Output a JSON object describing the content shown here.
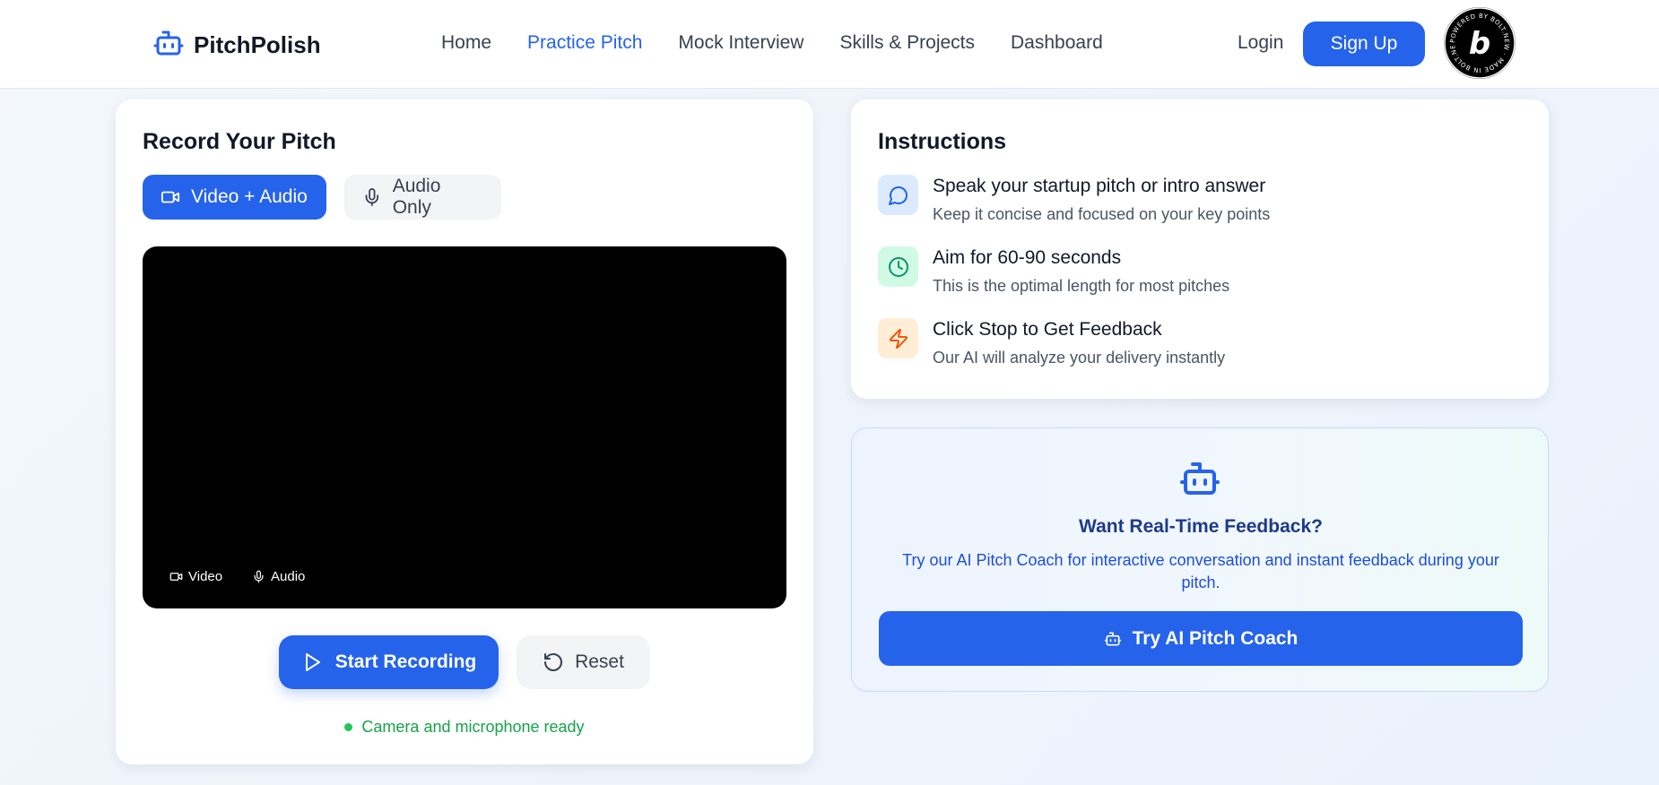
{
  "header": {
    "logo_text": "PitchPolish",
    "nav": [
      "Home",
      "Practice Pitch",
      "Mock Interview",
      "Skills & Projects",
      "Dashboard"
    ],
    "active_nav": "Practice Pitch",
    "login_label": "Login",
    "signup_label": "Sign Up",
    "badge_text": "POWERED BY BOLT.NEW · MADE IN BOLT.NEW"
  },
  "recorder": {
    "title": "Record Your Pitch",
    "mode_video_label": "Video + Audio",
    "mode_audio_label": "Audio Only",
    "selected_mode": "Video + Audio",
    "indicator_video": "Video",
    "indicator_audio": "Audio",
    "start_label": "Start Recording",
    "reset_label": "Reset",
    "status_text": "Camera and microphone ready"
  },
  "instructions": {
    "title": "Instructions",
    "items": [
      {
        "icon": "message-circle-icon",
        "heading": "Speak your startup pitch or intro answer",
        "sub": "Keep it concise and focused on your key points"
      },
      {
        "icon": "clock-icon",
        "heading": "Aim for 60-90 seconds",
        "sub": "This is the optimal length for most pitches"
      },
      {
        "icon": "zap-icon",
        "heading": "Click Stop to Get Feedback",
        "sub": "Our AI will analyze your delivery instantly"
      }
    ]
  },
  "coach": {
    "title": "Want Real-Time Feedback?",
    "text": "Try our AI Pitch Coach for interactive conversation and instant feedback during your pitch.",
    "button_label": "Try AI Pitch Coach"
  },
  "colors": {
    "accent": "#2563eb",
    "status_green": "#16a34a"
  }
}
